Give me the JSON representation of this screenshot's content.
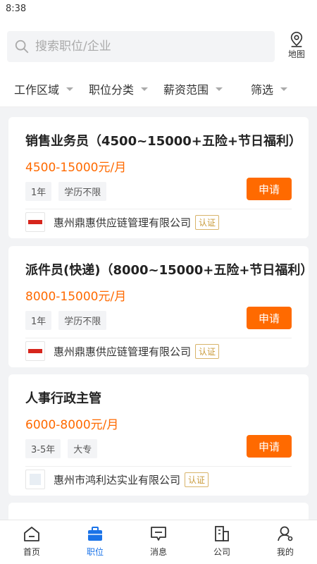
{
  "status_bar": {
    "time": "8:38"
  },
  "search": {
    "placeholder": "搜索职位/企业"
  },
  "map": {
    "label": "地图"
  },
  "filters": [
    {
      "label": "工作区域"
    },
    {
      "label": "职位分类"
    },
    {
      "label": "薪资范围"
    },
    {
      "label": "筛选"
    }
  ],
  "jobs": [
    {
      "title": "销售业务员（4500~15000+五险+节日福利）",
      "salary": "4500-15000元/月",
      "tags": [
        "1年",
        "学历不限"
      ],
      "apply_label": "申请",
      "company": "惠州鼎惠供应链管理有限公司",
      "verified": "认证"
    },
    {
      "title": "派件员(快递)（8000~15000+五险+节日福利）",
      "salary": "8000-15000元/月",
      "tags": [
        "1年",
        "学历不限"
      ],
      "apply_label": "申请",
      "company": "惠州鼎惠供应链管理有限公司",
      "verified": "认证"
    },
    {
      "title": "人事行政主管",
      "salary": "6000-8000元/月",
      "tags": [
        "3-5年",
        "大专"
      ],
      "apply_label": "申请",
      "company": "惠州市鸿利达实业有限公司",
      "verified": "认证"
    }
  ],
  "tabs": [
    {
      "label": "首页",
      "icon": "home-icon"
    },
    {
      "label": "职位",
      "icon": "briefcase-icon",
      "active": true
    },
    {
      "label": "消息",
      "icon": "message-icon"
    },
    {
      "label": "公司",
      "icon": "building-icon"
    },
    {
      "label": "我的",
      "icon": "profile-icon"
    }
  ],
  "colors": {
    "accent": "#ff6a00",
    "active_tab": "#1a73e8",
    "verified": "#c99a3a"
  }
}
